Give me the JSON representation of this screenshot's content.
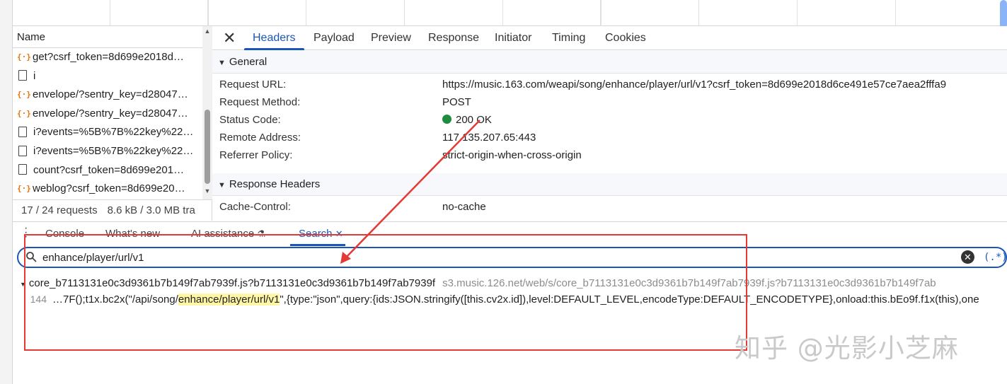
{
  "request_list": {
    "column_name": "Name",
    "rows": [
      {
        "label": "get?csrf_token=8d699e2018d…",
        "type": "script"
      },
      {
        "label": "i",
        "type": "doc"
      },
      {
        "label": "envelope/?sentry_key=d28047…",
        "type": "script"
      },
      {
        "label": "envelope/?sentry_key=d28047…",
        "type": "script"
      },
      {
        "label": "i?events=%5B%7B%22key%22…",
        "type": "doc"
      },
      {
        "label": "i?events=%5B%7B%22key%22…",
        "type": "doc"
      },
      {
        "label": "count?csrf_token=8d699e201…",
        "type": "doc"
      },
      {
        "label": "weblog?csrf_token=8d699e20…",
        "type": "script"
      }
    ],
    "summary": {
      "requests": "17 / 24 requests",
      "transferred": "8.6 kB / 3.0 MB tra"
    }
  },
  "detail": {
    "close_glyph": "✕",
    "tabs": [
      "Headers",
      "Payload",
      "Preview",
      "Response",
      "Initiator",
      "Timing",
      "Cookies"
    ],
    "active_tab": "Headers",
    "general": {
      "title": "General",
      "fields": [
        {
          "key": "Request URL:",
          "value": "https://music.163.com/weapi/song/enhance/player/url/v1?csrf_token=8d699e2018d6ce491e57ce7aea2fffa9"
        },
        {
          "key": "Request Method:",
          "value": "POST"
        },
        {
          "key": "Status Code:",
          "value": "200 OK",
          "status_color": "#1e8e3e"
        },
        {
          "key": "Remote Address:",
          "value": "117.135.207.65:443"
        },
        {
          "key": "Referrer Policy:",
          "value": "strict-origin-when-cross-origin"
        }
      ]
    },
    "response_headers": {
      "title": "Response Headers",
      "fields": [
        {
          "key": "Cache-Control:",
          "value": "no-cache"
        }
      ]
    }
  },
  "drawer": {
    "tabs": [
      "Console",
      "What's new",
      "AI assistance",
      "Search"
    ],
    "active_tab": "Search",
    "search": {
      "value": "enhance/player/url/v1",
      "regex_label": "(.*)"
    },
    "result": {
      "file": "core_b7113131e0c3d9361b7b149f7ab7939f.js?b7113131e0c3d9361b7b149f7ab7939f",
      "url": "s3.music.126.net/web/s/core_b7113131e0c3d9361b7b149f7ab7939f.js?b7113131e0c3d9361b7b149f7ab",
      "line_number": "144",
      "code_before": "…7F();t1x.bc2x(\"/api/song/",
      "code_match": "enhance/player/url/v1",
      "code_after": "\",{type:\"json\",query:{ids:JSON.stringify([this.cv2x.id]),level:DEFAULT_LEVEL,encodeType:DEFAULT_ENCODETYPE},onload:this.bEo9f.f1x(this),one"
    }
  },
  "colors": {
    "accent": "#1a56b8",
    "annotation": "#e53935",
    "highlight": "#fff6a6"
  },
  "watermark": "知乎 @光影小芝麻"
}
